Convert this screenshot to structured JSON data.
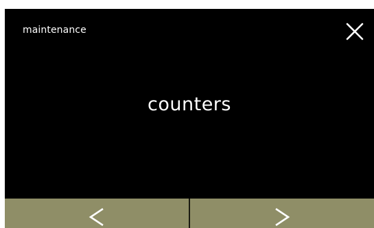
{
  "header": {
    "title": "maintenance",
    "close_icon": "close-icon"
  },
  "main": {
    "label": "counters"
  },
  "nav": {
    "prev_icon": "chevron-left-icon",
    "next_icon": "chevron-right-icon",
    "button_color": "#8f8e67"
  },
  "colors": {
    "background": "#000000",
    "text": "#ffffff"
  }
}
